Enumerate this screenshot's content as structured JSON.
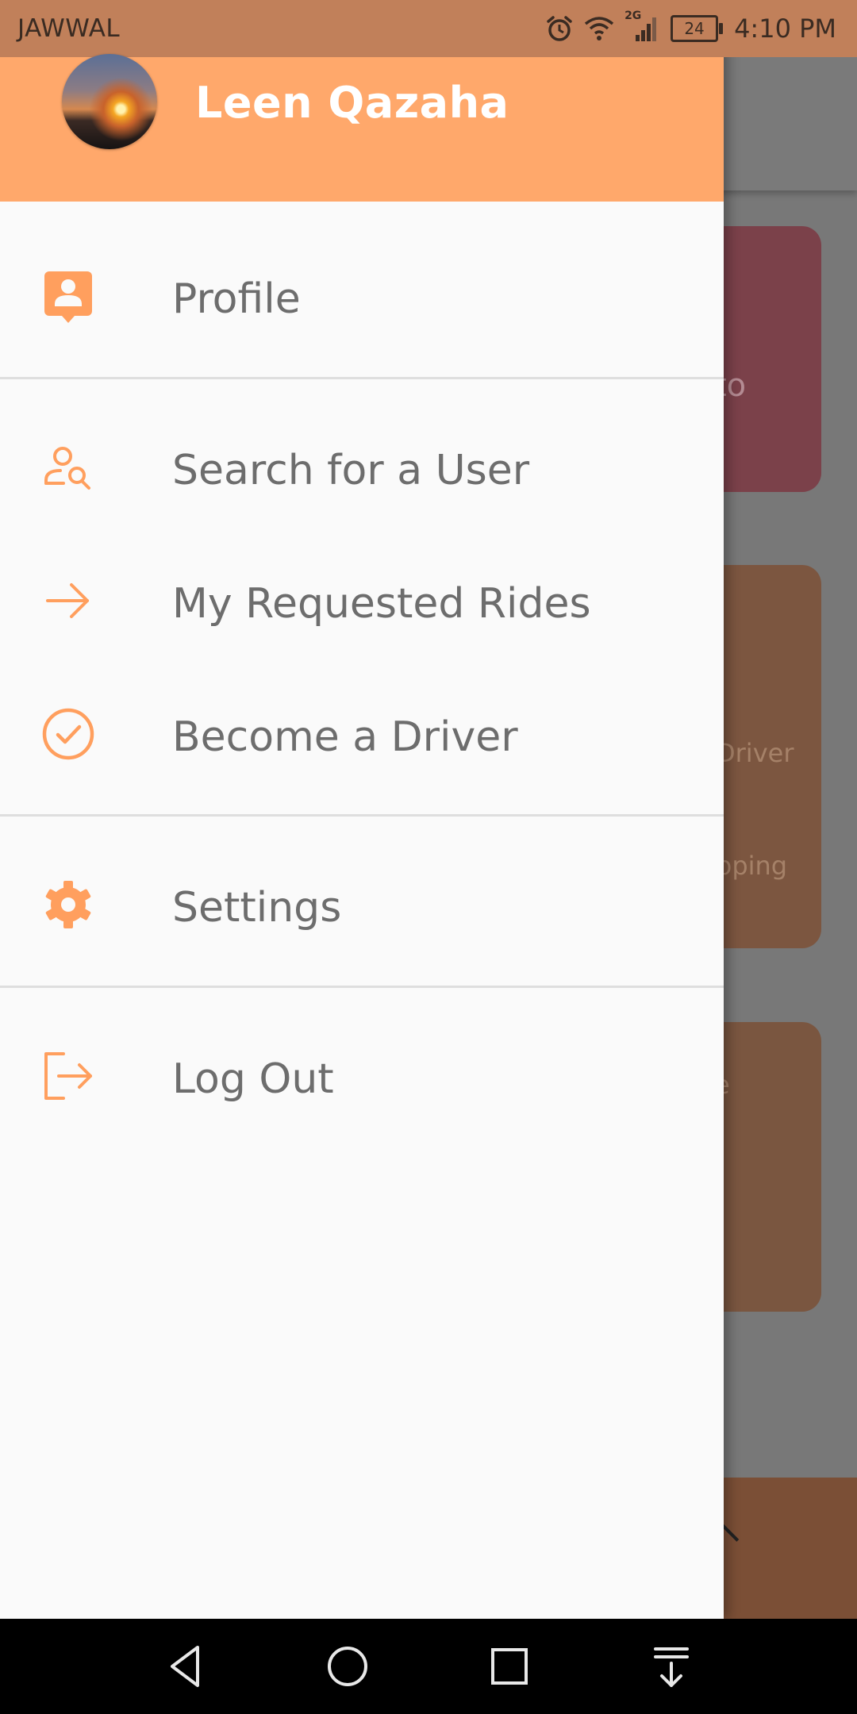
{
  "status_bar": {
    "carrier": "JAWWAL",
    "network_label": "2G",
    "battery": "24",
    "time": "4:10 PM"
  },
  "drawer": {
    "user_name": "Leen Qazaha",
    "sections": [
      {
        "items": [
          {
            "label": "Profile",
            "icon": "account-box-icon"
          }
        ]
      },
      {
        "items": [
          {
            "label": "Search for a User",
            "icon": "user-search-icon"
          },
          {
            "label": "My Requested Rides",
            "icon": "arrow-right-icon"
          },
          {
            "label": "Become a Driver",
            "icon": "check-circle-icon"
          }
        ]
      },
      {
        "items": [
          {
            "label": "Settings",
            "icon": "gear-icon"
          }
        ]
      },
      {
        "items": [
          {
            "label": "Log Out",
            "icon": "logout-icon"
          }
        ]
      }
    ]
  },
  "background": {
    "card_1_text": "to",
    "card_2_text_1": "Driver",
    "card_2_text_2": "pping",
    "card_3_text": "e"
  },
  "colors": {
    "accent": "#ffa86b",
    "icon": "#ff9f5e",
    "label": "#6d6d6d",
    "status_bar": "#c1805a"
  }
}
